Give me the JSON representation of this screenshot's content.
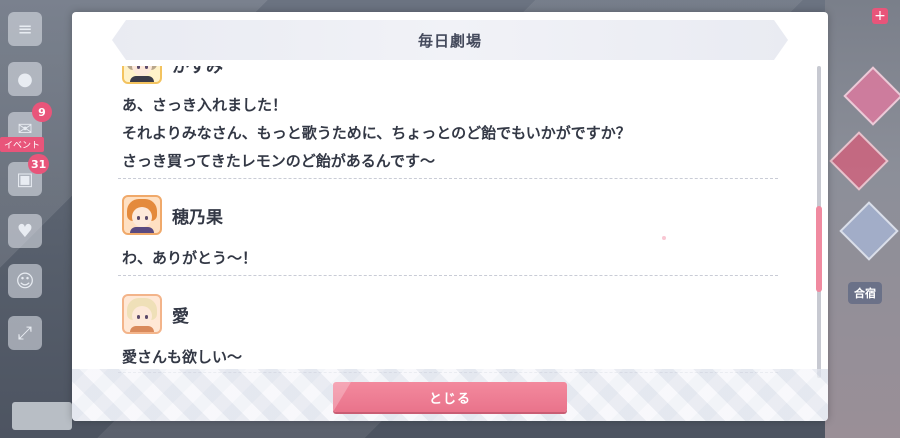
{
  "modal": {
    "title": "毎日劇場",
    "close_label": "とじる"
  },
  "dialogue": [
    {
      "speaker": "かすみ",
      "lines": [
        "あ、さっき入れました！",
        "それよりみなさん、もっと歌うために、ちょっとのど飴でもいかがですか？",
        "さっき買ってきたレモンのど飴があるんです〜"
      ]
    },
    {
      "speaker": "穂乃果",
      "lines": [
        "わ、ありがとう〜！"
      ]
    },
    {
      "speaker": "愛",
      "lines": [
        "愛さんも欲しい〜"
      ]
    }
  ],
  "sidebar": {
    "badges": [
      "9",
      "31"
    ],
    "event_tag": "イベント"
  },
  "right_panel": {
    "label": "合宿"
  },
  "colors": {
    "accent": "#e9738b",
    "badge": "#e8557a",
    "text": "#333845"
  }
}
